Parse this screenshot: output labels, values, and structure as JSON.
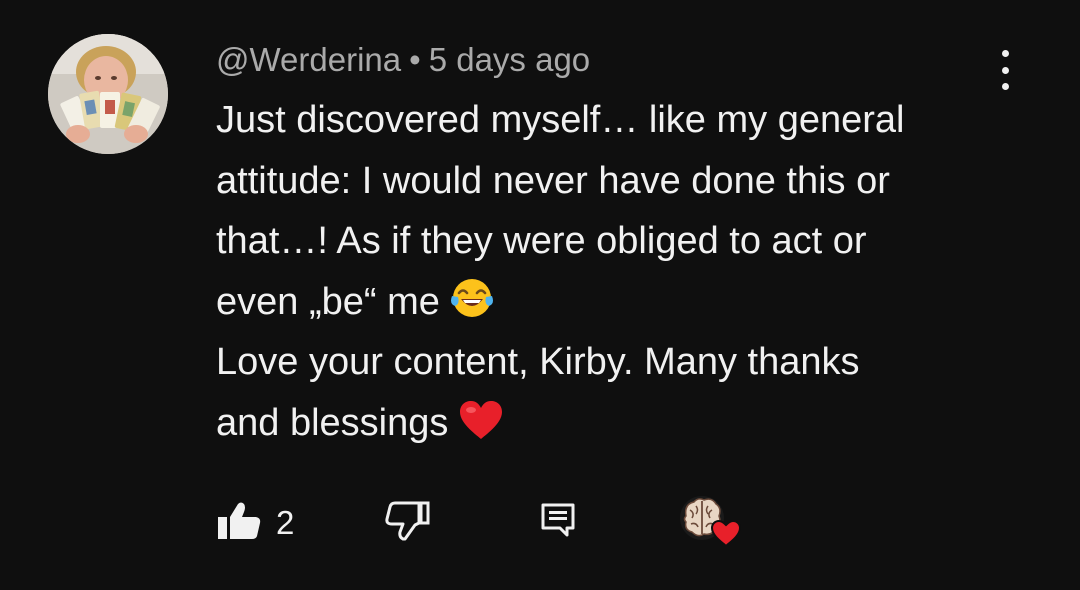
{
  "comment": {
    "author": "@Werderina",
    "separator": "•",
    "timestamp": "5 days ago",
    "lines": [
      "Just discovered myself… like my general",
      "attitude: I would never have done this or",
      "that…! As if they were obliged to act or",
      "even „be“ me",
      "Love your content, Kirby. Many thanks",
      "and blessings"
    ],
    "emojis": {
      "line4": "face-with-tears-of-joy",
      "line6": "red-heart"
    }
  },
  "actions": {
    "like_count": "2"
  },
  "icons": {
    "menu": "more-vertical-icon",
    "like": "thumbs-up-icon",
    "dislike": "thumbs-down-icon",
    "reply": "reply-comment-icon",
    "creator_heart": "creator-heart-icon"
  },
  "colors": {
    "background": "#0f0f0f",
    "text": "#f1f1f1",
    "meta_text": "#aaaaaa",
    "heart": "#e8202a"
  }
}
